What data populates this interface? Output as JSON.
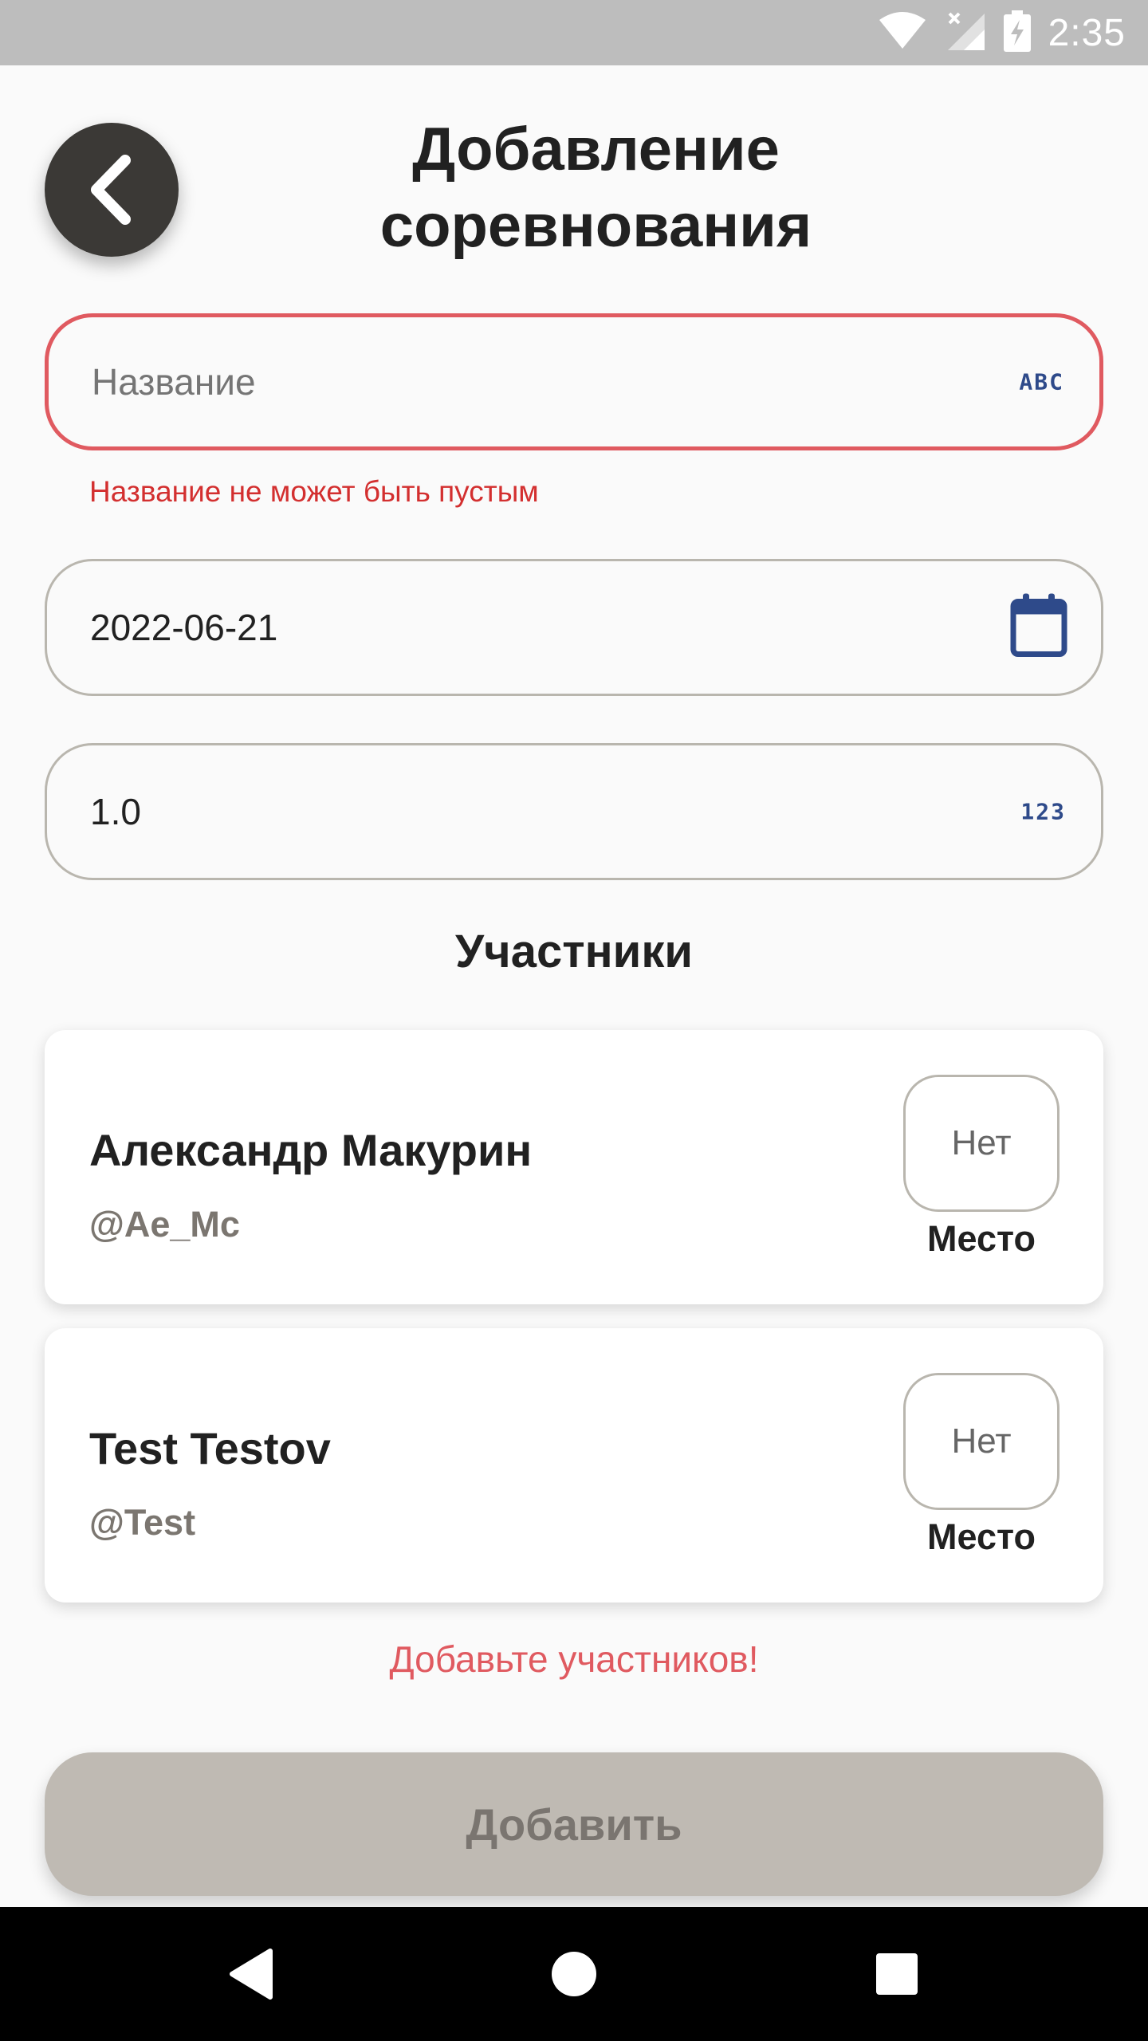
{
  "status_bar": {
    "time": "2:35"
  },
  "header": {
    "title_line1": "Добавление",
    "title_line2": "соревнования"
  },
  "form": {
    "name": {
      "placeholder": "Название",
      "value": "",
      "suffix": "ABC",
      "error": "Название не может быть пустым"
    },
    "date": {
      "value": "2022-06-21"
    },
    "coefficient": {
      "value": "1.0",
      "suffix": "123"
    }
  },
  "participants": {
    "title": "Участники",
    "items": [
      {
        "name": "Александр Макурин",
        "handle": "@Ae_Mc",
        "place_value": "Нет",
        "place_label": "Место"
      },
      {
        "name": "Test Testov",
        "handle": "@Test",
        "place_value": "Нет",
        "place_label": "Место"
      }
    ],
    "warning": "Добавьте участников!"
  },
  "submit": {
    "label": "Добавить"
  },
  "colors": {
    "error": "#e05a60",
    "accent": "#2e4a8a",
    "button_disabled": "#bfbab3",
    "back_button": "#3b3936"
  }
}
